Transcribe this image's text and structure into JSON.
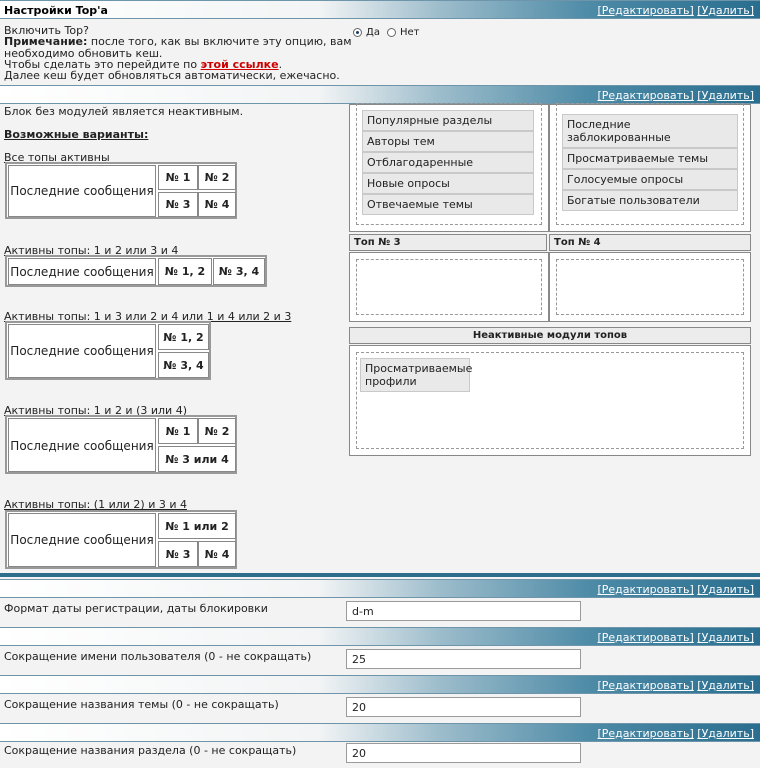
{
  "section1": {
    "title": "Настройки Top'а",
    "edit": "[Редактировать]",
    "delete": "[Удалить]",
    "enable_label": "Включить Top?",
    "note_bold": "Примечание:",
    "note_line1": "после того, как вы включите эту опцию, вам",
    "note_line2": "необходимо обновить кеш.",
    "note_line3_pre": "Чтобы сделать это перейдите по",
    "note_link": "этой ссылке",
    "note_line3_post": ".",
    "note_line4": "Далее кеш будет обновляться автоматически, ежечасно.",
    "radio_yes": "Да",
    "radio_no": "Нет"
  },
  "section2": {
    "edit": "[Редактировать]",
    "delete": "[Удалить]",
    "intro": "Блок без модулей является неактивным.",
    "variants_title": "Возможные варианты:",
    "v1_title": "Все топы активны",
    "v2_title": "Активны топы: 1 и 2 или 3 и 4",
    "v3_title": "Активны топы: 1 и 3 или 2 и 4 или 1 и 4 или 2 и 3",
    "v4_title": "Активны топы: 1 и 2 и (3 или 4)",
    "v5_title": "Активны топы: (1 или 2) и 3 и 4",
    "last_posts": "Последние сообщения",
    "n1": "№ 1",
    "n2": "№ 2",
    "n3": "№ 3",
    "n4": "№ 4",
    "n12": "№ 1, 2",
    "n34": "№ 3, 4",
    "n3or4": "№ 3 или 4",
    "n1or2": "№ 1 или 2",
    "top1_modules": [
      "Популярные разделы",
      "Авторы тем",
      "Отблагодаренные",
      "Новые опросы",
      "Отвечаемые темы"
    ],
    "top2_modules": [
      "Последние заблокированные",
      "Просматриваемые темы",
      "Голосуемые опросы",
      "Богатые пользователи"
    ],
    "top3_header": "Топ № 3",
    "top4_header": "Топ № 4",
    "inactive_header": "Неактивные модули топов",
    "inactive_modules": [
      "Просматриваемые профили"
    ]
  },
  "section3": {
    "edit": "[Редактировать]",
    "delete": "[Удалить]",
    "label": "Формат даты регистрации, даты блокировки",
    "value": "d-m"
  },
  "section4": {
    "edit": "[Редактировать]",
    "delete": "[Удалить]",
    "label": "Сокращение имени пользователя (0 - не сокращать)",
    "value": "25"
  },
  "section5": {
    "edit": "[Редактировать]",
    "delete": "[Удалить]",
    "label": "Сокращение названия темы (0 - не сокращать)",
    "value": "20"
  },
  "section6": {
    "edit": "[Редактировать]",
    "delete": "[Удалить]",
    "label": "Сокращение названия раздела (0 - не сокращать)",
    "value": "20"
  },
  "colors": {
    "bar_dark": "#2a6e8f",
    "link_red": "#cc0000",
    "module_bg": "#e9e9e9"
  }
}
